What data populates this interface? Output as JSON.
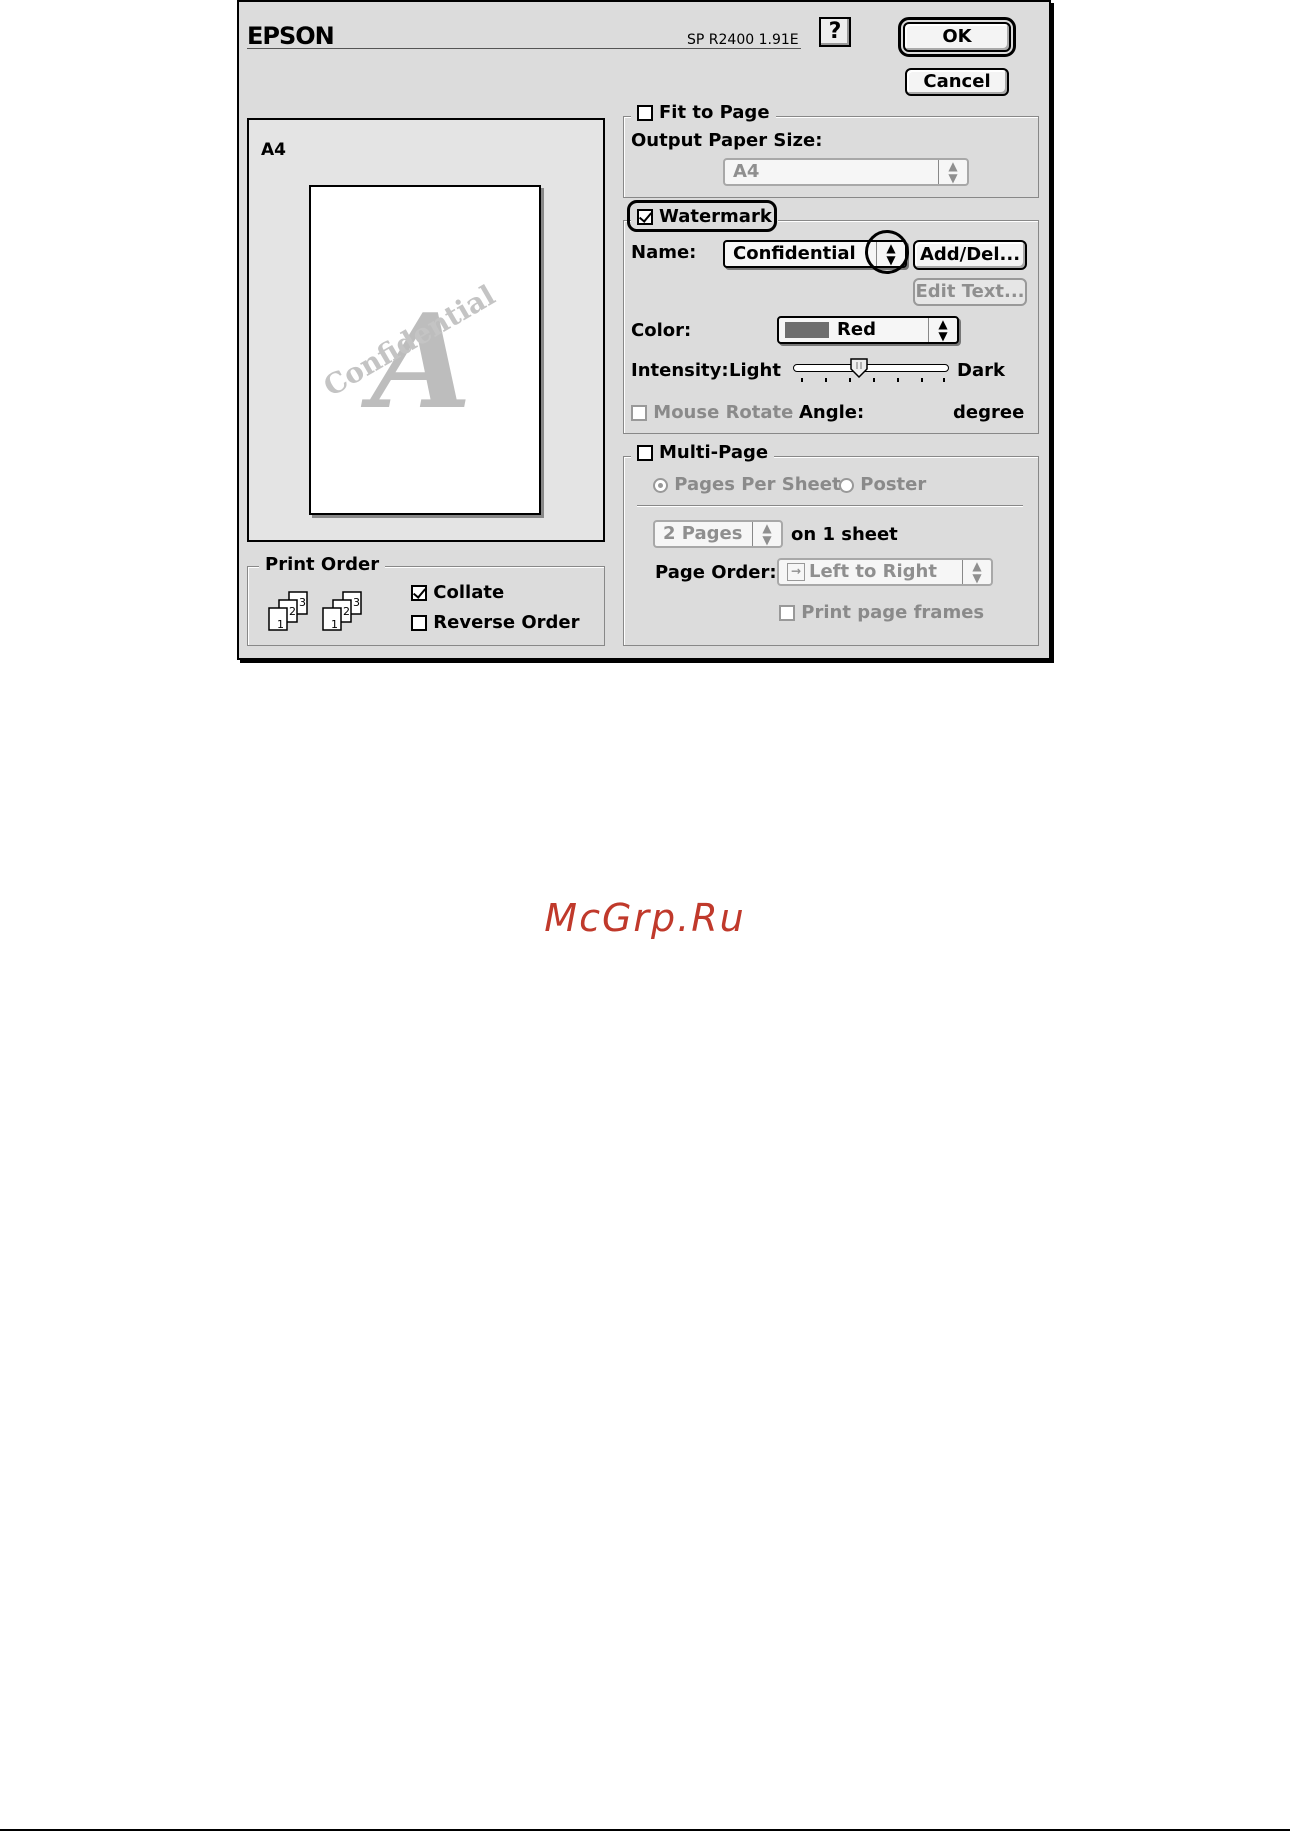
{
  "header": {
    "brand": "EPSON",
    "model": "SP R2400 1.91E",
    "help_label": "?",
    "ok_label": "OK",
    "cancel_label": "Cancel"
  },
  "preview": {
    "paper_label": "A4",
    "watermark_text": "Confidential",
    "watermark_letter": "A"
  },
  "print_order": {
    "title": "Print Order",
    "collate_label": "Collate",
    "collate_checked": true,
    "reverse_label": "Reverse Order",
    "reverse_checked": false,
    "icon_digits": [
      "1",
      "2",
      "3"
    ]
  },
  "fit_to_page": {
    "label": "Fit to Page",
    "checked": false,
    "output_label": "Output Paper Size:",
    "output_value": "A4"
  },
  "watermark": {
    "label": "Watermark",
    "checked": true,
    "name_label": "Name:",
    "name_value": "Confidential",
    "add_del_label": "Add/Del...",
    "edit_text_label": "Edit Text...",
    "color_label": "Color:",
    "color_value": "Red",
    "color_swatch": "#6e6e6e",
    "intensity_label": "Intensity:",
    "intensity_light": "Light",
    "intensity_dark": "Dark",
    "intensity_level": 0.42,
    "mouse_rotate_label": "Mouse Rotate",
    "angle_label": "Angle:",
    "degree_label": "degree"
  },
  "multi_page": {
    "label": "Multi-Page",
    "checked": false,
    "pages_per_sheet_label": "Pages Per Sheet",
    "poster_label": "Poster",
    "pages_value": "2 Pages",
    "on_sheet_label": "on 1 sheet",
    "page_order_label": "Page Order:",
    "page_order_value": "Left to Right",
    "frames_label": "Print page frames"
  },
  "footer": {
    "site": "McGrp.Ru"
  }
}
